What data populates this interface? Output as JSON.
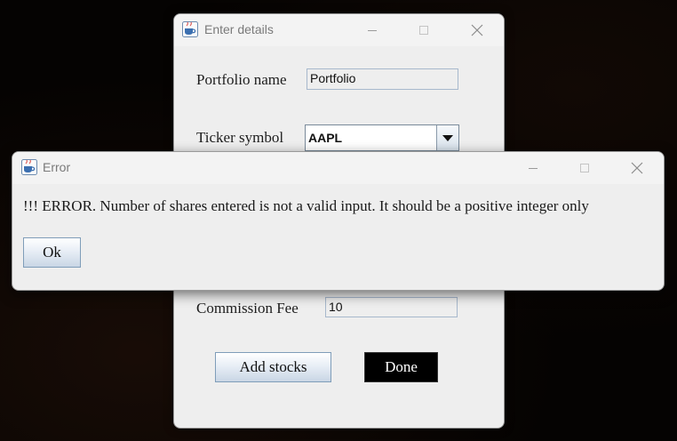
{
  "enter_details": {
    "title": "Enter details",
    "portfolio_name_label": "Portfolio name",
    "portfolio_name_value": "Portfolio",
    "ticker_label": "Ticker symbol",
    "ticker_value": "AAPL",
    "commission_label": "Commission Fee",
    "commission_value": "10",
    "add_stocks_label": "Add stocks",
    "done_label": "Done"
  },
  "error_dialog": {
    "title": "Error",
    "message": "!!! ERROR. Number of shares entered is not a valid input. It should be a positive integer only",
    "ok_label": "Ok"
  },
  "icons": {
    "app_icon": "java-cup-icon",
    "minimize": "minimize-icon",
    "maximize": "maximize-icon",
    "close": "close-icon",
    "dropdown": "chevron-down-icon"
  },
  "colors": {
    "window_bg": "#eeeeee",
    "desktop_bg": "#050302",
    "done_button_bg": "#000000",
    "field_border": "#a7b8cc"
  }
}
